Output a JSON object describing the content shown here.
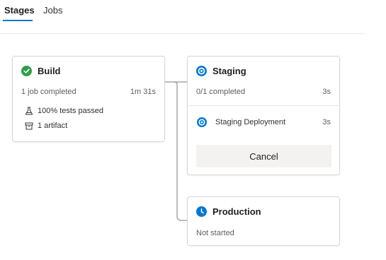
{
  "tabs": [
    {
      "label": "Stages"
    },
    {
      "label": "Jobs"
    }
  ],
  "build": {
    "title": "Build",
    "status": "1 job completed",
    "duration": "1m 31s",
    "tests": "100% tests passed",
    "artifact": "1 artifact"
  },
  "staging": {
    "title": "Staging",
    "status": "0/1 completed",
    "duration": "3s",
    "job": {
      "label": "Staging Deployment",
      "duration": "3s"
    },
    "cancel_label": "Cancel"
  },
  "production": {
    "title": "Production",
    "status": "Not started"
  },
  "colors": {
    "success": "#2e9d47",
    "running": "#0078d4",
    "pending": "#0078d4",
    "connector": "#a6a6a6"
  },
  "icons": {
    "build": "check-circle-icon",
    "tests": "beaker-icon",
    "artifact": "artifact-box-icon",
    "staging": "running-icon",
    "staging_job": "running-icon",
    "production": "clock-icon"
  }
}
